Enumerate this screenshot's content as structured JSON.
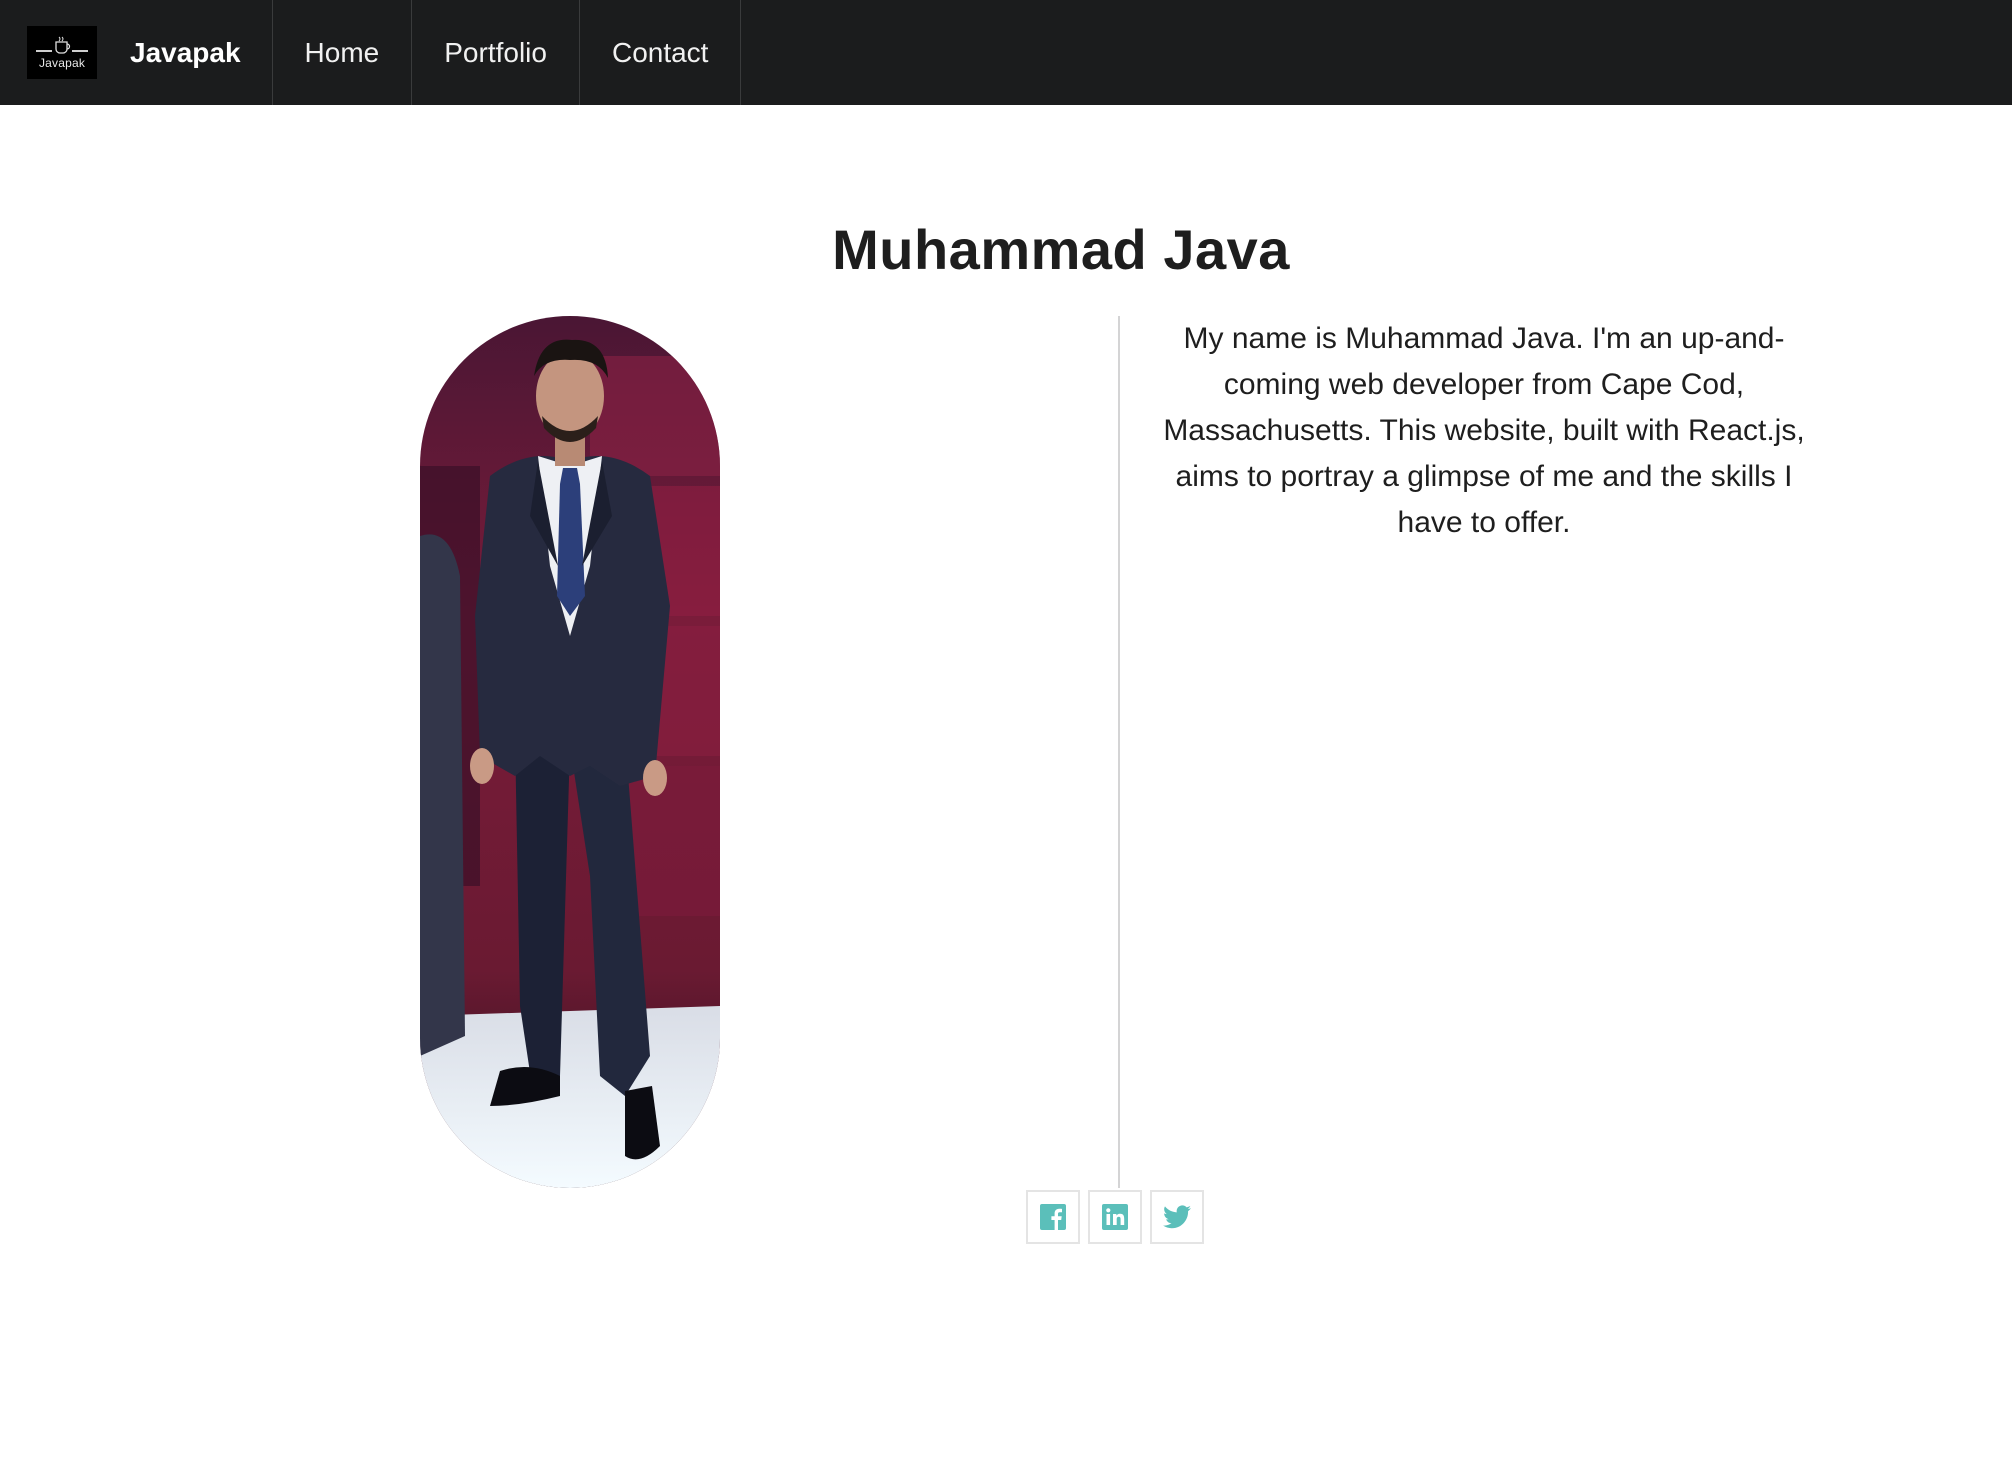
{
  "navbar": {
    "logo_text": "Javapak",
    "brand": "Javapak",
    "items": [
      {
        "label": "Home"
      },
      {
        "label": "Portfolio"
      },
      {
        "label": "Contact"
      }
    ],
    "background": "#1b1c1d"
  },
  "profile": {
    "name": "Muhammad Java",
    "bio": "My name is Muhammad Java. I'm an up-and-coming web developer from Cape Cod, Massachusetts. This website, built with React.js, aims to portray a glimpse of me and the skills I have to offer.",
    "photo_icon": "profile-photo"
  },
  "social": {
    "accent": "#5bbfba",
    "links": [
      {
        "icon": "facebook-icon"
      },
      {
        "icon": "linkedin-icon"
      },
      {
        "icon": "twitter-icon"
      }
    ]
  }
}
